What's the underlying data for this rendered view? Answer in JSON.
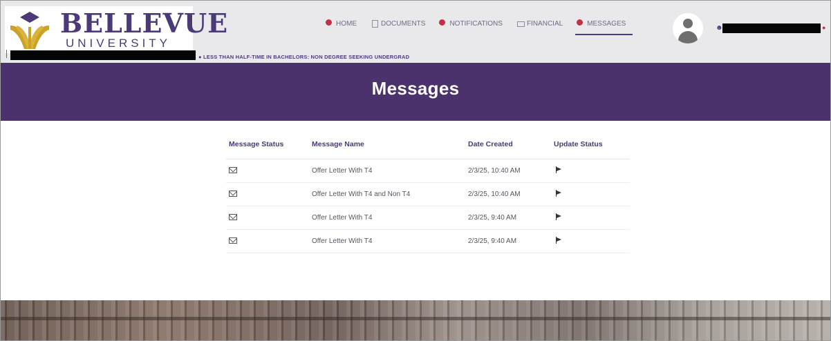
{
  "header": {
    "logo": {
      "name": "BELLEVUE",
      "sub": "UNIVERSITY"
    },
    "program": "● LESS THAN HALF-TIME IN BACHELORS: NON DEGREE SEEKING UNDERGRAD",
    "nav": [
      {
        "label": "HOME",
        "icon": "notification-badge-icon"
      },
      {
        "label": "DOCUMENTS",
        "icon": "document-icon"
      },
      {
        "label": "NOTIFICATIONS",
        "icon": "notification-badge-icon"
      },
      {
        "label": "FINANCIAL",
        "icon": "financial-icon"
      },
      {
        "label": "MESSAGES",
        "icon": "notification-badge-icon",
        "active": true
      }
    ]
  },
  "banner": {
    "title": "Messages"
  },
  "table": {
    "headers": [
      "Message Status",
      "Message Name",
      "Date Created",
      "Update Status"
    ],
    "rows": [
      {
        "name": "Offer Letter With T4",
        "date": "2/3/25, 10:40 AM"
      },
      {
        "name": "Offer Letter With T4 and Non T4",
        "date": "2/3/25, 10:40 AM"
      },
      {
        "name": "Offer Letter With T4",
        "date": "2/3/25, 9:40 AM"
      },
      {
        "name": "Offer Letter With T4",
        "date": "2/3/25, 9:40 AM"
      }
    ]
  },
  "colors": {
    "brand": "#4c3a78",
    "banner": "#4b326d",
    "badge": "#c0304a",
    "header_bg": "#e9e9ec"
  }
}
